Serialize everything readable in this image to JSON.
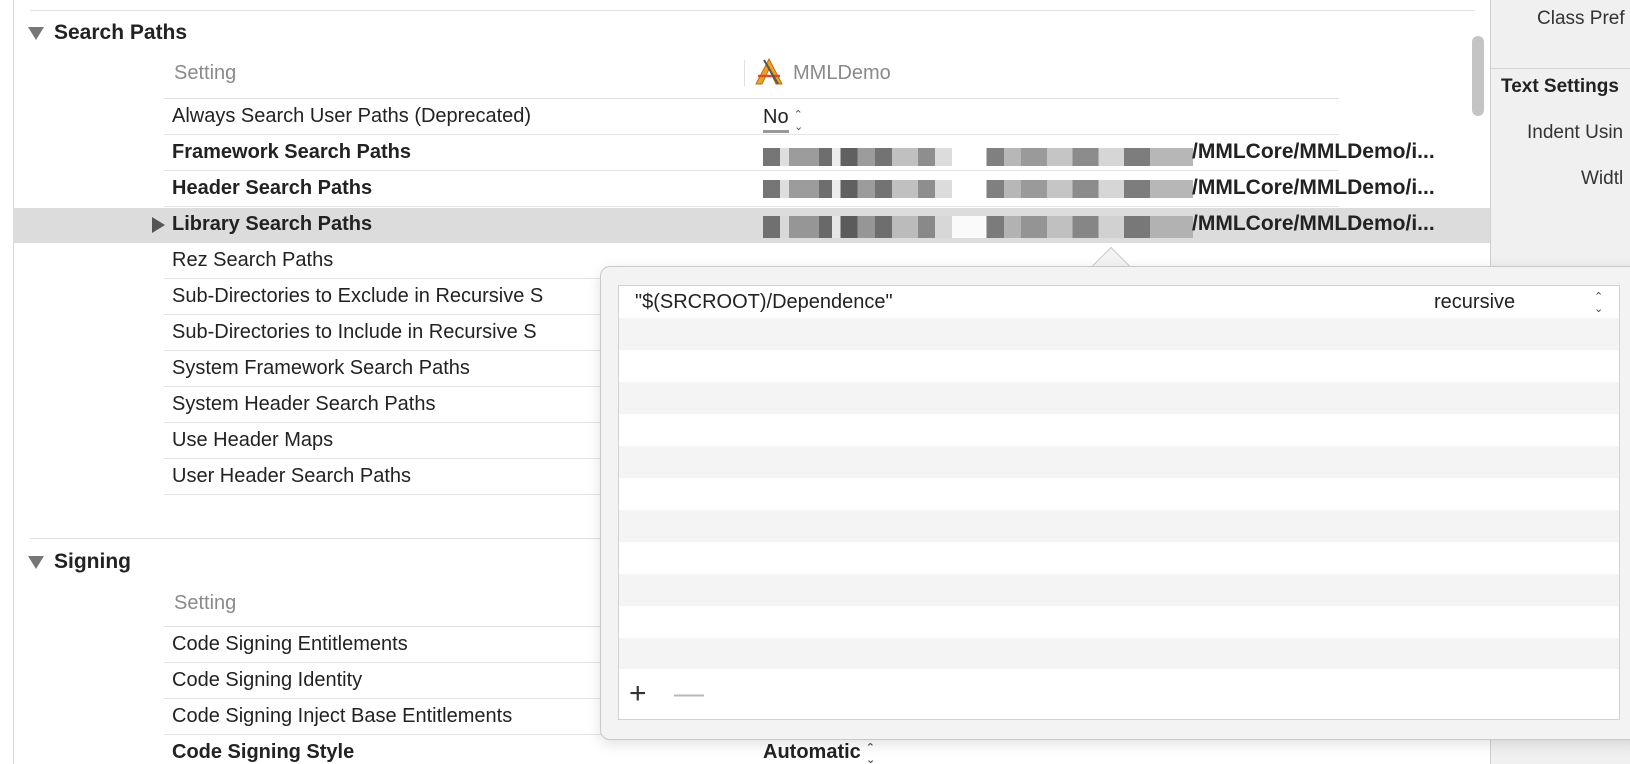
{
  "search_paths": {
    "section_title": "Search Paths",
    "column_setting": "Setting",
    "column_target": "MMLDemo",
    "rows": [
      {
        "name": "Always Search User Paths (Deprecated)",
        "bold": false,
        "value": "No",
        "type": "popup"
      },
      {
        "name": "Framework Search Paths",
        "bold": true,
        "value": "/MMLCore/MMLDemo/i...",
        "type": "path"
      },
      {
        "name": "Header Search Paths",
        "bold": true,
        "value": "/MMLCore/MMLDemo/i...",
        "type": "path"
      },
      {
        "name": "Library Search Paths",
        "bold": true,
        "value": "/MMLCore/MMLDemo/i...",
        "type": "path",
        "selected": true
      },
      {
        "name": "Rez Search Paths",
        "bold": false
      },
      {
        "name": "Sub-Directories to Exclude in Recursive S",
        "bold": false
      },
      {
        "name": "Sub-Directories to Include in Recursive S",
        "bold": false
      },
      {
        "name": "System Framework Search Paths",
        "bold": false
      },
      {
        "name": "System Header Search Paths",
        "bold": false
      },
      {
        "name": "Use Header Maps",
        "bold": false
      },
      {
        "name": "User Header Search Paths",
        "bold": false
      }
    ]
  },
  "signing": {
    "section_title": "Signing",
    "column_setting": "Setting",
    "rows": [
      {
        "name": "Code Signing Entitlements",
        "bold": false
      },
      {
        "name": "Code Signing Identity",
        "bold": false
      },
      {
        "name": "Code Signing Inject Base Entitlements",
        "bold": false
      },
      {
        "name": "Code Signing Style",
        "bold": true,
        "value": "Automatic"
      }
    ]
  },
  "inspector": {
    "class_prefix_label": "Class Pref",
    "text_settings_title": "Text Settings",
    "indent_label": "Indent Usin",
    "width_label": "Widtl"
  },
  "popover": {
    "entries": [
      {
        "path": "\"$(SRCROOT)/Dependence\"",
        "mode": "recursive"
      }
    ],
    "empty_rows": 11,
    "add_label": "+",
    "remove_label": "—"
  },
  "icons": {
    "disclosure_open": "triangle-down-icon",
    "disclosure_closed": "triangle-right-icon",
    "stepper": "up-down-chevron-icon",
    "app": "xcode-app-icon"
  }
}
